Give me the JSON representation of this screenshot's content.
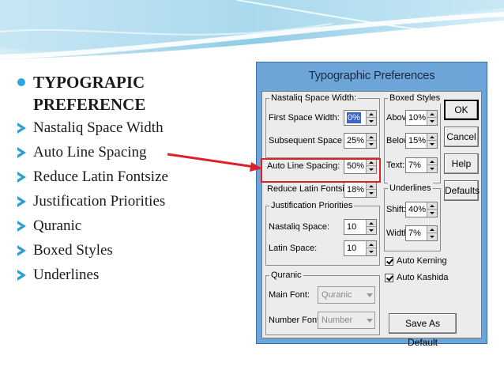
{
  "bullets": {
    "heading_line1": "TYPOGRAPIC",
    "heading_line2": "PREFERENCE",
    "items": [
      "Nastaliq Space Width",
      "Auto Line Spacing",
      "Reduce Latin Fontsize",
      "Justification Priorities",
      "Quranic",
      "Boxed Styles",
      "Underlines"
    ]
  },
  "dialog": {
    "title": "Typographic Preferences",
    "nastaliq_group": {
      "title": "Nastaliq Space Width:",
      "first_label": "First Space Width:",
      "first_value": "0%",
      "subsequent_label": "Subsequent Space Width:",
      "subsequent_value": "25%"
    },
    "auto_line_label": "Auto Line Spacing:",
    "auto_line_value": "50%",
    "reduce_latin_label": "Reduce Latin Fontsize:",
    "reduce_latin_value": "18%",
    "justification_group": {
      "title": "Justification Priorities",
      "nastaliq_label": "Nastaliq Space:",
      "nastaliq_value": "10",
      "latin_label": "Latin Space:",
      "latin_value": "10"
    },
    "quranic_group": {
      "title": "Quranic",
      "main_font_label": "Main Font:",
      "main_font_value": "Quranic",
      "number_font_label": "Number Font:",
      "number_font_value": "Number"
    },
    "boxed_group": {
      "title": "Boxed Styles",
      "above_label": "Above:",
      "above_value": "10%",
      "below_label": "Below:",
      "below_value": "15%",
      "text_label": "Text:",
      "text_value": "7%"
    },
    "underlines_group": {
      "title": "Underlines",
      "shift_label": "Shift:",
      "shift_value": "40%",
      "width_label": "Width:",
      "width_value": "7%"
    },
    "auto_kerning_label": "Auto Kerning",
    "auto_kashida_label": "Auto Kashida",
    "buttons": {
      "ok": "OK",
      "cancel": "Cancel",
      "help": "Help",
      "defaults": "Defaults",
      "save_default": "Save As Default"
    }
  },
  "colors": {
    "accent": "#29a9d9",
    "highlight": "#d8232a",
    "dialog_frame": "#6ea5d8"
  }
}
